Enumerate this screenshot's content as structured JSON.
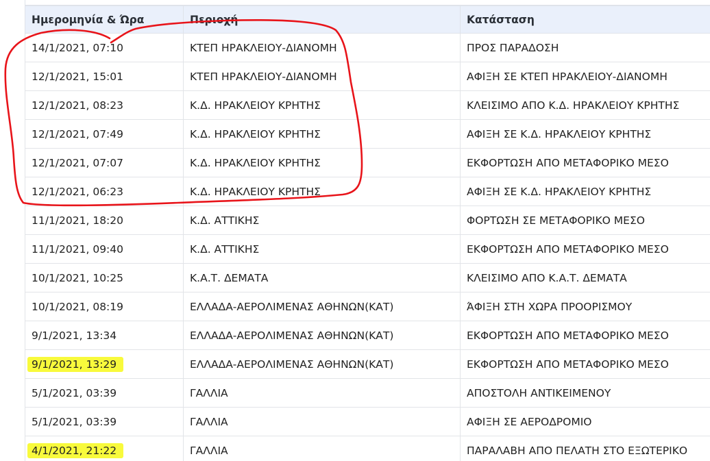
{
  "table": {
    "headers": [
      "Ημερομηνία & Ώρα",
      "Περιοχή",
      "Κατάσταση"
    ],
    "rows": [
      {
        "date": "14/1/2021, 07:10",
        "area": "ΚΤΕΠ ΗΡΑΚΛΕΙΟΥ-ΔΙΑΝΟΜΗ",
        "status": "ΠΡΟΣ ΠΑΡΑΔΟΣΗ",
        "highlighted": false
      },
      {
        "date": "12/1/2021, 15:01",
        "area": "ΚΤΕΠ ΗΡΑΚΛΕΙΟΥ-ΔΙΑΝΟΜΗ",
        "status": "ΑΦΙΞΗ ΣΕ ΚΤΕΠ ΗΡΑΚΛΕΙΟΥ-ΔΙΑΝΟΜΗ",
        "highlighted": false
      },
      {
        "date": "12/1/2021, 08:23",
        "area": "Κ.Δ. ΗΡΑΚΛΕΙΟΥ ΚΡΗΤΗΣ",
        "status": "ΚΛΕΙΣΙΜΟ ΑΠΟ Κ.Δ. ΗΡΑΚΛΕΙΟΥ ΚΡΗΤΗΣ",
        "highlighted": false
      },
      {
        "date": "12/1/2021, 07:49",
        "area": "Κ.Δ. ΗΡΑΚΛΕΙΟΥ ΚΡΗΤΗΣ",
        "status": "ΑΦΙΞΗ ΣΕ Κ.Δ. ΗΡΑΚΛΕΙΟΥ ΚΡΗΤΗΣ",
        "highlighted": false
      },
      {
        "date": "12/1/2021, 07:07",
        "area": "Κ.Δ. ΗΡΑΚΛΕΙΟΥ ΚΡΗΤΗΣ",
        "status": "ΕΚΦΟΡΤΩΣΗ ΑΠΟ ΜΕΤΑΦΟΡΙΚΟ ΜΕΣΟ",
        "highlighted": false
      },
      {
        "date": "12/1/2021, 06:23",
        "area": "Κ.Δ. ΗΡΑΚΛΕΙΟΥ ΚΡΗΤΗΣ",
        "status": "ΑΦΙΞΗ ΣΕ Κ.Δ. ΗΡΑΚΛΕΙΟΥ ΚΡΗΤΗΣ",
        "highlighted": false
      },
      {
        "date": "11/1/2021, 18:20",
        "area": "Κ.Δ. ΑΤΤΙΚΗΣ",
        "status": "ΦΟΡΤΩΣΗ ΣΕ ΜΕΤΑΦΟΡΙΚΟ ΜΕΣΟ",
        "highlighted": false
      },
      {
        "date": "11/1/2021, 09:40",
        "area": "Κ.Δ. ΑΤΤΙΚΗΣ",
        "status": "ΕΚΦΟΡΤΩΣΗ ΑΠΟ ΜΕΤΑΦΟΡΙΚΟ ΜΕΣΟ",
        "highlighted": false
      },
      {
        "date": "10/1/2021, 10:25",
        "area": "Κ.Α.Τ. ΔΕΜΑΤΑ",
        "status": "ΚΛΕΙΣΙΜΟ ΑΠΟ Κ.Α.Τ. ΔΕΜΑΤΑ",
        "highlighted": false
      },
      {
        "date": "10/1/2021, 08:19",
        "area": "ΕΛΛΑΔΑ-ΑΕΡΟΛΙΜΕΝΑΣ ΑΘΗΝΩΝ(ΚΑΤ)",
        "status": "ΆΦΙΞΗ ΣΤΗ ΧΩΡΑ ΠΡΟΟΡΙΣΜΟΥ",
        "highlighted": false
      },
      {
        "date": "9/1/2021, 13:34",
        "area": "ΕΛΛΑΔΑ-ΑΕΡΟΛΙΜΕΝΑΣ ΑΘΗΝΩΝ(ΚΑΤ)",
        "status": "ΕΚΦΟΡΤΩΣΗ ΑΠΟ ΜΕΤΑΦΟΡΙΚΟ ΜΕΣΟ",
        "highlighted": false
      },
      {
        "date": "9/1/2021, 13:29",
        "area": "ΕΛΛΑΔΑ-ΑΕΡΟΛΙΜΕΝΑΣ ΑΘΗΝΩΝ(ΚΑΤ)",
        "status": "ΕΚΦΟΡΤΩΣΗ ΑΠΟ ΜΕΤΑΦΟΡΙΚΟ ΜΕΣΟ",
        "highlighted": true
      },
      {
        "date": "5/1/2021, 03:39",
        "area": "ΓΑΛΛΙΑ",
        "status": "ΑΠΟΣΤΟΛΗ ΑΝΤΙΚΕΙΜΕΝΟΥ",
        "highlighted": false
      },
      {
        "date": "5/1/2021, 03:39",
        "area": "ΓΑΛΛΙΑ",
        "status": "ΑΦΙΞΗ ΣΕ ΑΕΡΟΔΡΟΜΙΟ",
        "highlighted": false
      },
      {
        "date": "4/1/2021, 21:22",
        "area": "ΓΑΛΛΙΑ",
        "status": "ΠΑΡΑΛΑΒΗ ΑΠΟ ΠΕΛΑΤΗ ΣΤΟ ΕΞΩΤΕΡΙΚΟ",
        "highlighted": true
      }
    ]
  },
  "colors": {
    "header_bg": "#eaf0fb",
    "highlight": "#f8fa3c",
    "annotation": "#e8141a"
  }
}
